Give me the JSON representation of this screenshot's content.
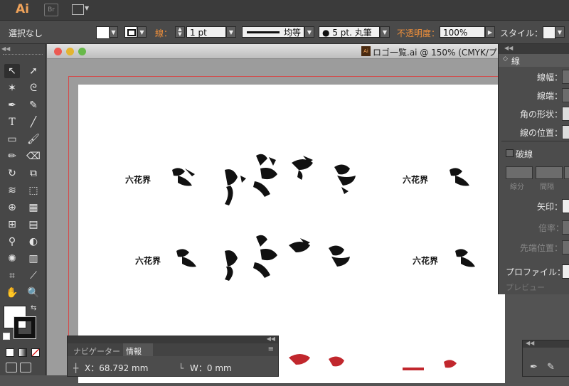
{
  "app": {
    "logo": "Ai",
    "bridge": "Br"
  },
  "control_bar": {
    "selection_label": "選択なし",
    "stroke_label": "線：",
    "stroke_weight": "1 pt",
    "profile_label": "均等",
    "brush_label": "5 pt. 丸筆",
    "opacity_label": "不透明度：",
    "opacity_value": "100%",
    "style_label": "スタイル："
  },
  "document": {
    "title": "ロゴ一覧.ai @ 150% (CMYK/プ"
  },
  "stroke_panel": {
    "tab": "線",
    "weight_label": "線幅：",
    "cap_label": "線端：",
    "corner_label": "角の形状：",
    "align_label": "線の位置：",
    "dashed_label": "破線",
    "dash_label": "線分",
    "gap_label": "間隔",
    "arrow_label": "矢印：",
    "scale_label": "倍率：",
    "tip_label": "先端位置：",
    "profile_label": "プロファイル：",
    "preview_label": "プレビュー"
  },
  "nav_panel": {
    "tab_navigator": "ナビゲーター",
    "tab_info": "情報",
    "x_label": "X：68.792 mm",
    "w_label": "W：0 mm"
  },
  "logos": {
    "rokkakai": "六花界"
  },
  "colors": {
    "accent_orange": "#ee8f3b",
    "guide_red": "#d54a4a",
    "logo_red": "#c1272d"
  },
  "icons": [
    "selection-tool-icon",
    "direct-selection-tool-icon",
    "magic-wand-icon",
    "lasso-icon",
    "pen-icon",
    "curvature-icon",
    "type-icon",
    "line-icon",
    "rectangle-icon",
    "paintbrush-icon",
    "pencil-icon",
    "eraser-icon",
    "rotate-icon",
    "scale-icon",
    "warp-icon",
    "free-transform-icon",
    "shape-builder-icon",
    "perspective-grid-icon",
    "mesh-icon",
    "gradient-icon",
    "eyedropper-icon",
    "blend-icon",
    "symbol-sprayer-icon",
    "column-graph-icon",
    "artboard-icon",
    "slice-icon",
    "hand-icon",
    "zoom-icon"
  ]
}
